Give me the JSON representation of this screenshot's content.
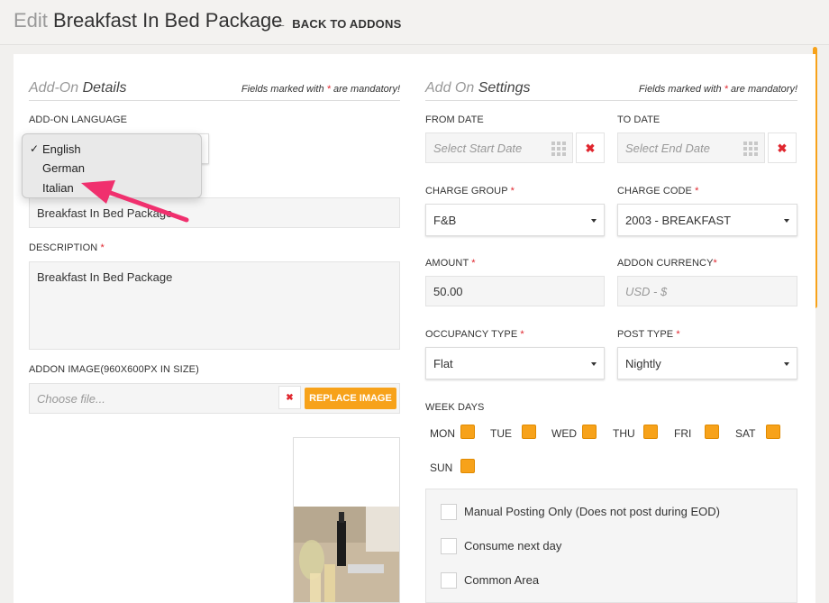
{
  "header": {
    "title_prefix": "Edit",
    "title": "Breakfast In Bed Package",
    "back_arrow": "←",
    "back_label": "BACK TO ADDONS"
  },
  "left": {
    "section_title_a": "Add-On",
    "section_title_b": "Details",
    "mandatory_a": "Fields marked with",
    "mandatory_star": "*",
    "mandatory_b": "are mandatory!",
    "language_label": "ADD-ON LANGUAGE",
    "language_options": [
      "English",
      "German",
      "Italian"
    ],
    "language_selected_mark": "✓",
    "name_value": "Breakfast In Bed Package",
    "description_label": "DESCRIPTION",
    "description_value": "Breakfast In Bed Package",
    "image_label": "ADDON IMAGE(960X600PX IN SIZE)",
    "image_placeholder": "Choose file...",
    "clear_icon": "✖",
    "replace_label": "REPLACE IMAGE"
  },
  "right": {
    "section_title_a": "Add On",
    "section_title_b": "Settings",
    "from_date_label": "FROM DATE",
    "from_date_placeholder": "Select Start Date",
    "to_date_label": "TO DATE",
    "to_date_placeholder": "Select End Date",
    "charge_group_label": "CHARGE GROUP",
    "charge_group_value": "F&B",
    "charge_code_label": "CHARGE CODE",
    "charge_code_value": "2003 - BREAKFAST",
    "amount_label": "AMOUNT",
    "amount_value": "50.00",
    "currency_label": "ADDON CURRENCY",
    "currency_placeholder": "USD - $",
    "occupancy_label": "OCCUPANCY TYPE",
    "occupancy_value": "Flat",
    "post_type_label": "POST TYPE",
    "post_type_value": "Nightly",
    "week_days_label": "WEEK DAYS",
    "week_days": [
      "MON",
      "TUE",
      "WED",
      "THU",
      "FRI",
      "SAT",
      "SUN"
    ],
    "options": [
      "Manual Posting Only (Does not post during EOD)",
      "Consume next day",
      "Common Area"
    ]
  },
  "colors": {
    "accent": "#f7a21a",
    "required": "#e0262e",
    "annotation_arrow": "#f0306e"
  }
}
